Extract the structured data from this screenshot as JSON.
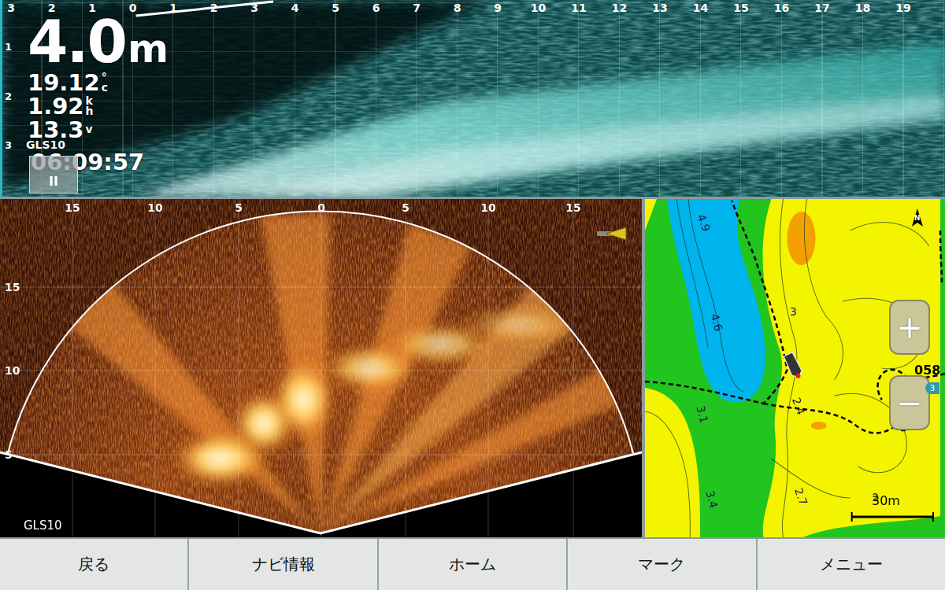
{
  "top_sonar": {
    "source": "GLS10",
    "depth": "4.0",
    "depth_unit": "m",
    "readings": [
      {
        "value": "19.12",
        "unit_top": "°",
        "unit_bottom": "c"
      },
      {
        "value": "1.92",
        "unit_top": "k",
        "unit_bottom": "h"
      },
      {
        "value": "13.3",
        "unit_top": "",
        "unit_bottom": "v"
      }
    ],
    "time": "06:09:57",
    "pause_button": "II",
    "distance_ticks": [
      "3",
      "2",
      "1",
      "0",
      "1",
      "2",
      "3",
      "4",
      "5",
      "6",
      "7",
      "8",
      "9",
      "10",
      "11",
      "12",
      "13",
      "14",
      "15",
      "16",
      "17",
      "18",
      "19"
    ],
    "depth_ticks": [
      "1",
      "2",
      "3"
    ]
  },
  "fan_sonar": {
    "source": "GLS10",
    "range_ticks": [
      "15",
      "10",
      "5",
      "0",
      "5",
      "10",
      "15"
    ],
    "depth_ticks": [
      "15",
      "10",
      "5"
    ]
  },
  "map": {
    "compass": "N",
    "depth_labels": [
      "4.9",
      "4.6",
      "3",
      "2.4",
      "3.1",
      "3.4",
      "2.7",
      "2"
    ],
    "heading": "058",
    "waypoint": "3",
    "zoom_in": "+",
    "zoom_out": "−",
    "scale": "30m"
  },
  "buttons": [
    {
      "label": "戻る"
    },
    {
      "label": "ナビ情報"
    },
    {
      "label": "ホーム"
    },
    {
      "label": "マーク"
    },
    {
      "label": "メニュー"
    }
  ]
}
